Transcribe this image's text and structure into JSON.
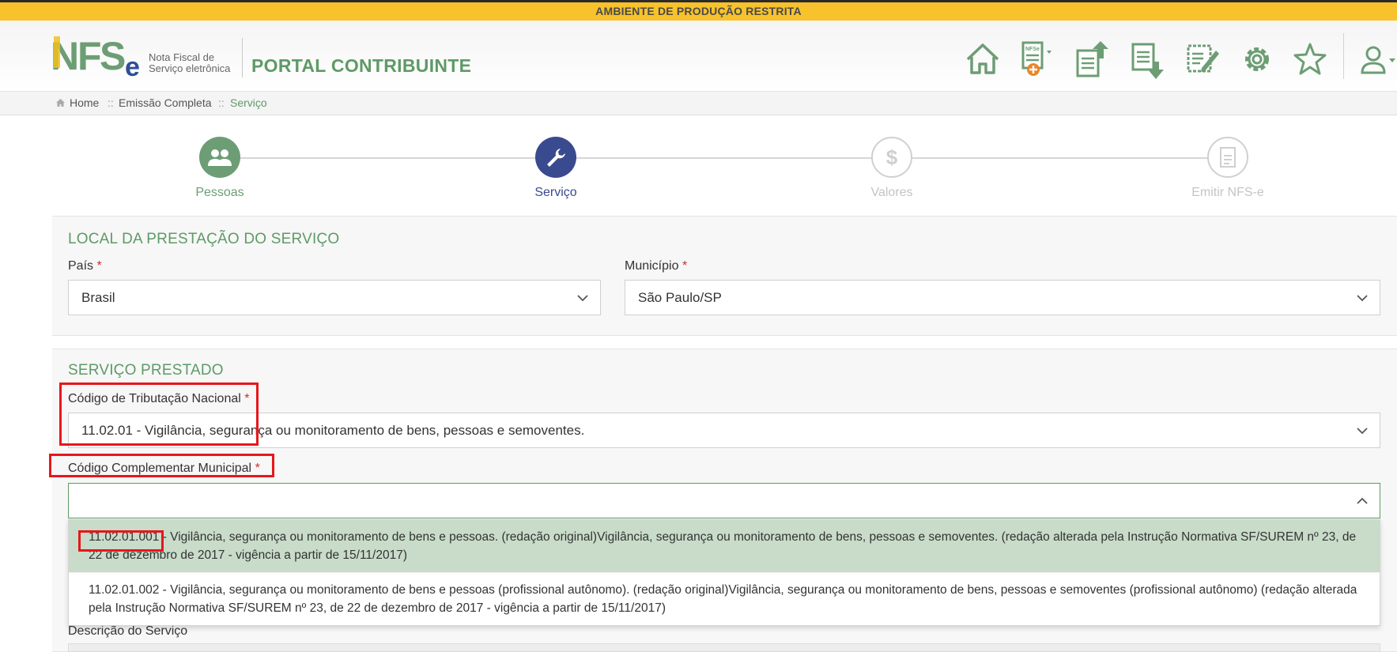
{
  "env_banner": "AMBIENTE DE PRODUÇÃO RESTRITA",
  "header": {
    "logo_sub_line1": "Nota Fiscal de",
    "logo_sub_line2": "Serviço eletrônica",
    "portal_title": "PORTAL CONTRIBUINTE",
    "icons": [
      "home-icon",
      "new-nfse-icon",
      "upload-doc-icon",
      "download-doc-icon",
      "edit-doc-icon",
      "gear-icon",
      "star-icon",
      "user-icon"
    ]
  },
  "breadcrumb": {
    "home": "Home",
    "sep": "::",
    "item2": "Emissão Completa",
    "current": "Serviço"
  },
  "steps": [
    {
      "label": "Pessoas",
      "state": "done"
    },
    {
      "label": "Serviço",
      "state": "active"
    },
    {
      "label": "Valores",
      "state": "pending"
    },
    {
      "label": "Emitir NFS-e",
      "state": "pending"
    }
  ],
  "local": {
    "title": "LOCAL DA PRESTAÇÃO DO SERVIÇO",
    "pais_label": "País",
    "pais_value": "Brasil",
    "municipio_label": "Município",
    "municipio_value": "São Paulo/SP",
    "required_mark": "*"
  },
  "servico": {
    "title": "SERVIÇO PRESTADO",
    "codigo_nacional_label": "Código de Tributação Nacional",
    "codigo_nacional_value": "11.02.01 - Vigilância, segurança ou monitoramento de bens, pessoas e semoventes.",
    "codigo_municipal_label": "Código Complementar Municipal",
    "codigo_municipal_value": "",
    "options": [
      {
        "code": "11.02.01.001",
        "text": " - Vigilância, segurança ou monitoramento de bens e pessoas. (redação original)Vigilância, segurança ou monitoramento de bens, pessoas e semoventes. (redação alterada pela Instrução Normativa SF/SUREM nº 23, de 22 de dezembro de 2017 - vigência a partir de 15/11/2017)"
      },
      {
        "code": "11.02.01.002",
        "text": " - Vigilância, segurança ou monitoramento de bens e pessoas (profissional autônomo). (redação original)Vigilância, segurança ou monitoramento de bens, pessoas e semoventes (profissional autônomo) (redação alterada pela Instrução Normativa SF/SUREM nº 23, de 22 de dezembro de 2017 - vigência a partir de 15/11/2017)"
      }
    ],
    "descricao_label": "Descrição do Serviço"
  },
  "colors": {
    "banner": "#f7c22b",
    "green": "#5e9a66",
    "active_step": "#394a8f",
    "highlight": "#c8dcc9",
    "annotation": "#e8161b"
  }
}
